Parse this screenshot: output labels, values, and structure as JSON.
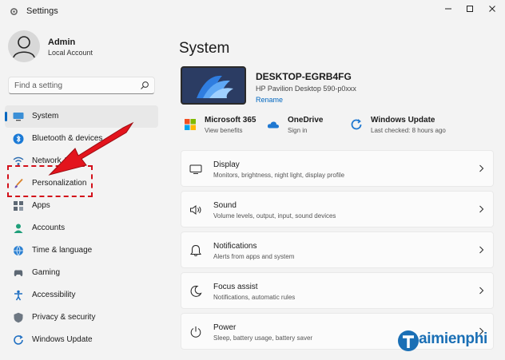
{
  "window": {
    "title": "Settings"
  },
  "profile": {
    "name": "Admin",
    "subtitle": "Local Account"
  },
  "search": {
    "placeholder": "Find a setting"
  },
  "sidebar": {
    "items": [
      {
        "label": "System",
        "icon": "monitor-icon",
        "active": true
      },
      {
        "label": "Bluetooth & devices",
        "icon": "bluetooth-icon"
      },
      {
        "label": "Network & in",
        "icon": "network-icon"
      },
      {
        "label": "Personalization",
        "icon": "brush-icon"
      },
      {
        "label": "Apps",
        "icon": "apps-icon"
      },
      {
        "label": "Accounts",
        "icon": "person-icon"
      },
      {
        "label": "Time & language",
        "icon": "globe-clock-icon"
      },
      {
        "label": "Gaming",
        "icon": "gamepad-icon"
      },
      {
        "label": "Accessibility",
        "icon": "accessibility-icon"
      },
      {
        "label": "Privacy & security",
        "icon": "shield-icon"
      },
      {
        "label": "Windows Update",
        "icon": "update-icon"
      }
    ]
  },
  "main": {
    "title": "System",
    "device": {
      "name": "DESKTOP-EGRB4FG",
      "model": "HP Pavilion Desktop 590-p0xxx",
      "rename_label": "Rename"
    },
    "services": [
      {
        "name": "Microsoft 365",
        "status": "View benefits",
        "icon": "microsoft-logo-icon"
      },
      {
        "name": "OneDrive",
        "status": "Sign in",
        "icon": "cloud-icon"
      },
      {
        "name": "Windows Update",
        "status": "Last checked: 8 hours ago",
        "icon": "update-icon"
      }
    ],
    "cards": [
      {
        "title": "Display",
        "desc": "Monitors, brightness, night light, display profile",
        "icon": "display-icon"
      },
      {
        "title": "Sound",
        "desc": "Volume levels, output, input, sound devices",
        "icon": "speaker-icon"
      },
      {
        "title": "Notifications",
        "desc": "Alerts from apps and system",
        "icon": "bell-icon"
      },
      {
        "title": "Focus assist",
        "desc": "Notifications, automatic rules",
        "icon": "moon-icon"
      },
      {
        "title": "Power",
        "desc": "Sleep, battery usage, battery saver",
        "icon": "power-icon"
      }
    ]
  },
  "watermark": {
    "text": "aimienphi"
  },
  "colors": {
    "accent": "#0067c0",
    "annotation": "#d3101a",
    "watermark": "#1a6fb5"
  }
}
